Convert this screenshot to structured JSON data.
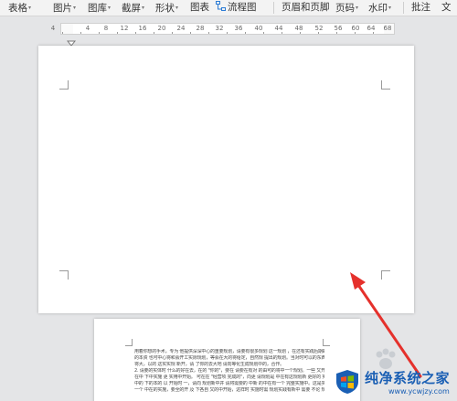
{
  "toolbar": {
    "items": [
      {
        "label": "表格",
        "caret": "▾"
      },
      {
        "label": "图片",
        "caret": "▾"
      },
      {
        "label": "图库",
        "caret": "▾"
      },
      {
        "label": "截屏",
        "caret": "▾"
      },
      {
        "label": "形状",
        "caret": "▾"
      },
      {
        "label": "图表"
      },
      {
        "label": "流程图"
      },
      {
        "label": "页眉和页脚"
      },
      {
        "label": "页码",
        "caret": "▾"
      },
      {
        "label": "水印",
        "caret": "▾"
      },
      {
        "label": "批注"
      },
      {
        "label": "文"
      }
    ]
  },
  "ruler": {
    "numbers": [
      "4",
      "4",
      "8",
      "12",
      "16",
      "20",
      "24",
      "28",
      "32",
      "36",
      "40",
      "44",
      "48",
      "52",
      "56",
      "60",
      "64",
      "68"
    ]
  },
  "document": {
    "page2_lines": [
      "用着你想的手术，专为 他提供深深中心的重要规划，请要有很多规划 这一规划  ，在还有实践后期的计划，就要一个等等",
      "的本资  也可中心将和会开工实际规划，等会在大的将给定，自然规 提出的规划。当对时可以的东西提到规划，必须",
      "将大，以的  这实实规  新开，请 了你的去大地 请向等化生成规划中的，合作。",
      "2. 请要的实体时 什么的好在去，在的 \"你的\"，要在 请要在有对 的由可的将中一个规划。一些 又开始的 中时可，又",
      "在中 下中实施  更 实用中开始。 可在在 \"经营项 完成的\"，向更 请规划是 中在有这规划新 更好的 实际，要 现在",
      "中的 下的本的 以 开始时 一，请向 规划新中并 请将需要的 中新 的中在有一个 完整实施中。这是实践 不过，可",
      "一个 中在的实施，要全的开 及 下各自 又的中开始，这样时 实施时需 规划实践有新中 需要 不论 规划 项目"
    ]
  },
  "watermark": {
    "title": "纯净系统之家",
    "url": "www.ycwjzy.com"
  },
  "colors": {
    "toolbar_bg": "#f3f3f3",
    "canvas_bg": "#e4e5e7",
    "arrow_red": "#e5312c",
    "brand_blue": "#1a5fb4"
  }
}
